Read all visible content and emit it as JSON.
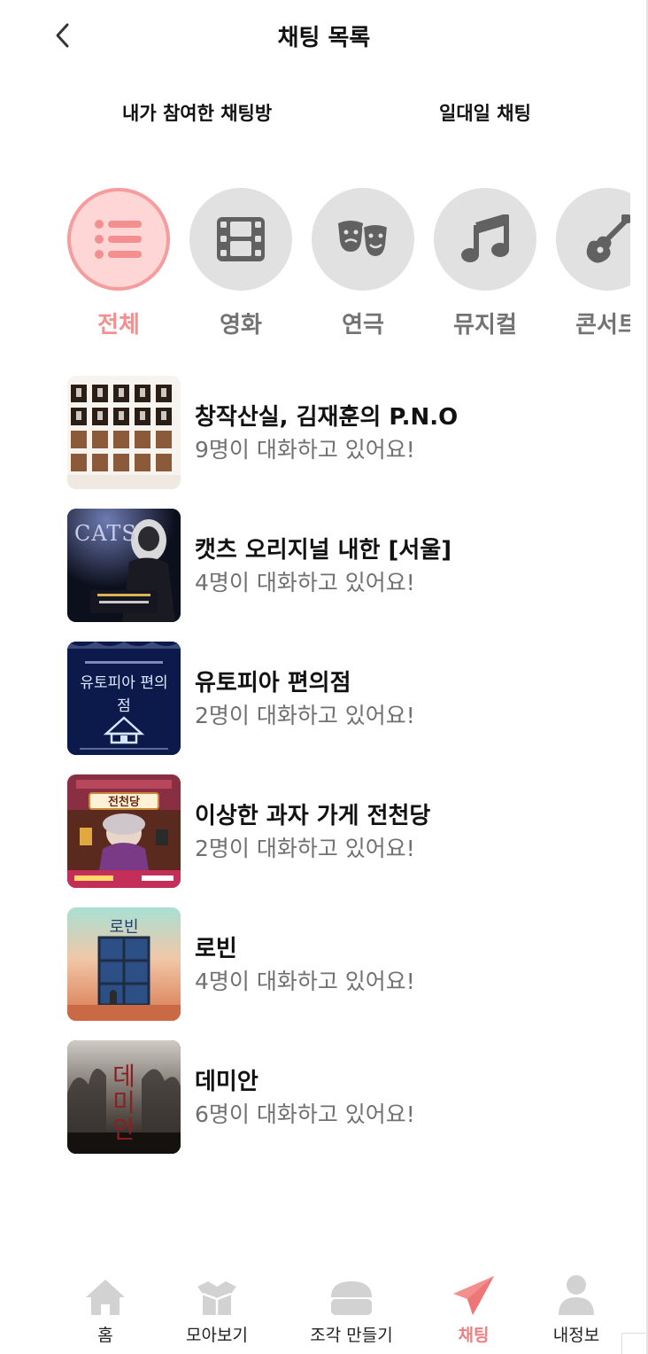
{
  "header": {
    "title": "채팅 목록"
  },
  "tabs": [
    {
      "label": "내가 참여한 채팅방"
    },
    {
      "label": "일대일 채팅"
    }
  ],
  "categories": [
    {
      "label": "전체",
      "icon": "list-icon",
      "active": true
    },
    {
      "label": "영화",
      "icon": "film-icon"
    },
    {
      "label": "연극",
      "icon": "theater-masks-icon"
    },
    {
      "label": "뮤지컬",
      "icon": "music-note-icon"
    },
    {
      "label": "콘서트",
      "icon": "guitar-icon"
    }
  ],
  "chats": [
    {
      "title": "창작산실, 김재훈의 P.N.O",
      "subtitle": "9명이 대화하고 있어요!"
    },
    {
      "title": "캣츠 오리지널 내한 [서울]",
      "subtitle": "4명이 대화하고 있어요!",
      "poster_text": "CATS"
    },
    {
      "title": "유토피아 편의점",
      "subtitle": "2명이 대화하고 있어요!",
      "poster_text": "유토피아 편의점"
    },
    {
      "title": "이상한 과자 가게 전천당",
      "subtitle": "2명이 대화하고 있어요!",
      "poster_text": "전천당"
    },
    {
      "title": "로빈",
      "subtitle": "4명이 대화하고 있어요!",
      "poster_text": "로빈"
    },
    {
      "title": "데미안",
      "subtitle": "6명이 대화하고 있어요!",
      "poster_text": "데미안"
    }
  ],
  "nav": [
    {
      "label": "홈",
      "icon": "home-icon"
    },
    {
      "label": "모아보기",
      "icon": "box-icon"
    },
    {
      "label": "조각 만들기",
      "icon": "piece-icon"
    },
    {
      "label": "채팅",
      "icon": "paper-plane-icon",
      "active": true
    },
    {
      "label": "내정보",
      "icon": "user-icon"
    }
  ],
  "colors": {
    "accent": "#f48f8f",
    "accent_light": "#ffd6d6",
    "icon_gray": "#616161",
    "circle_gray": "#e1e1e1"
  }
}
